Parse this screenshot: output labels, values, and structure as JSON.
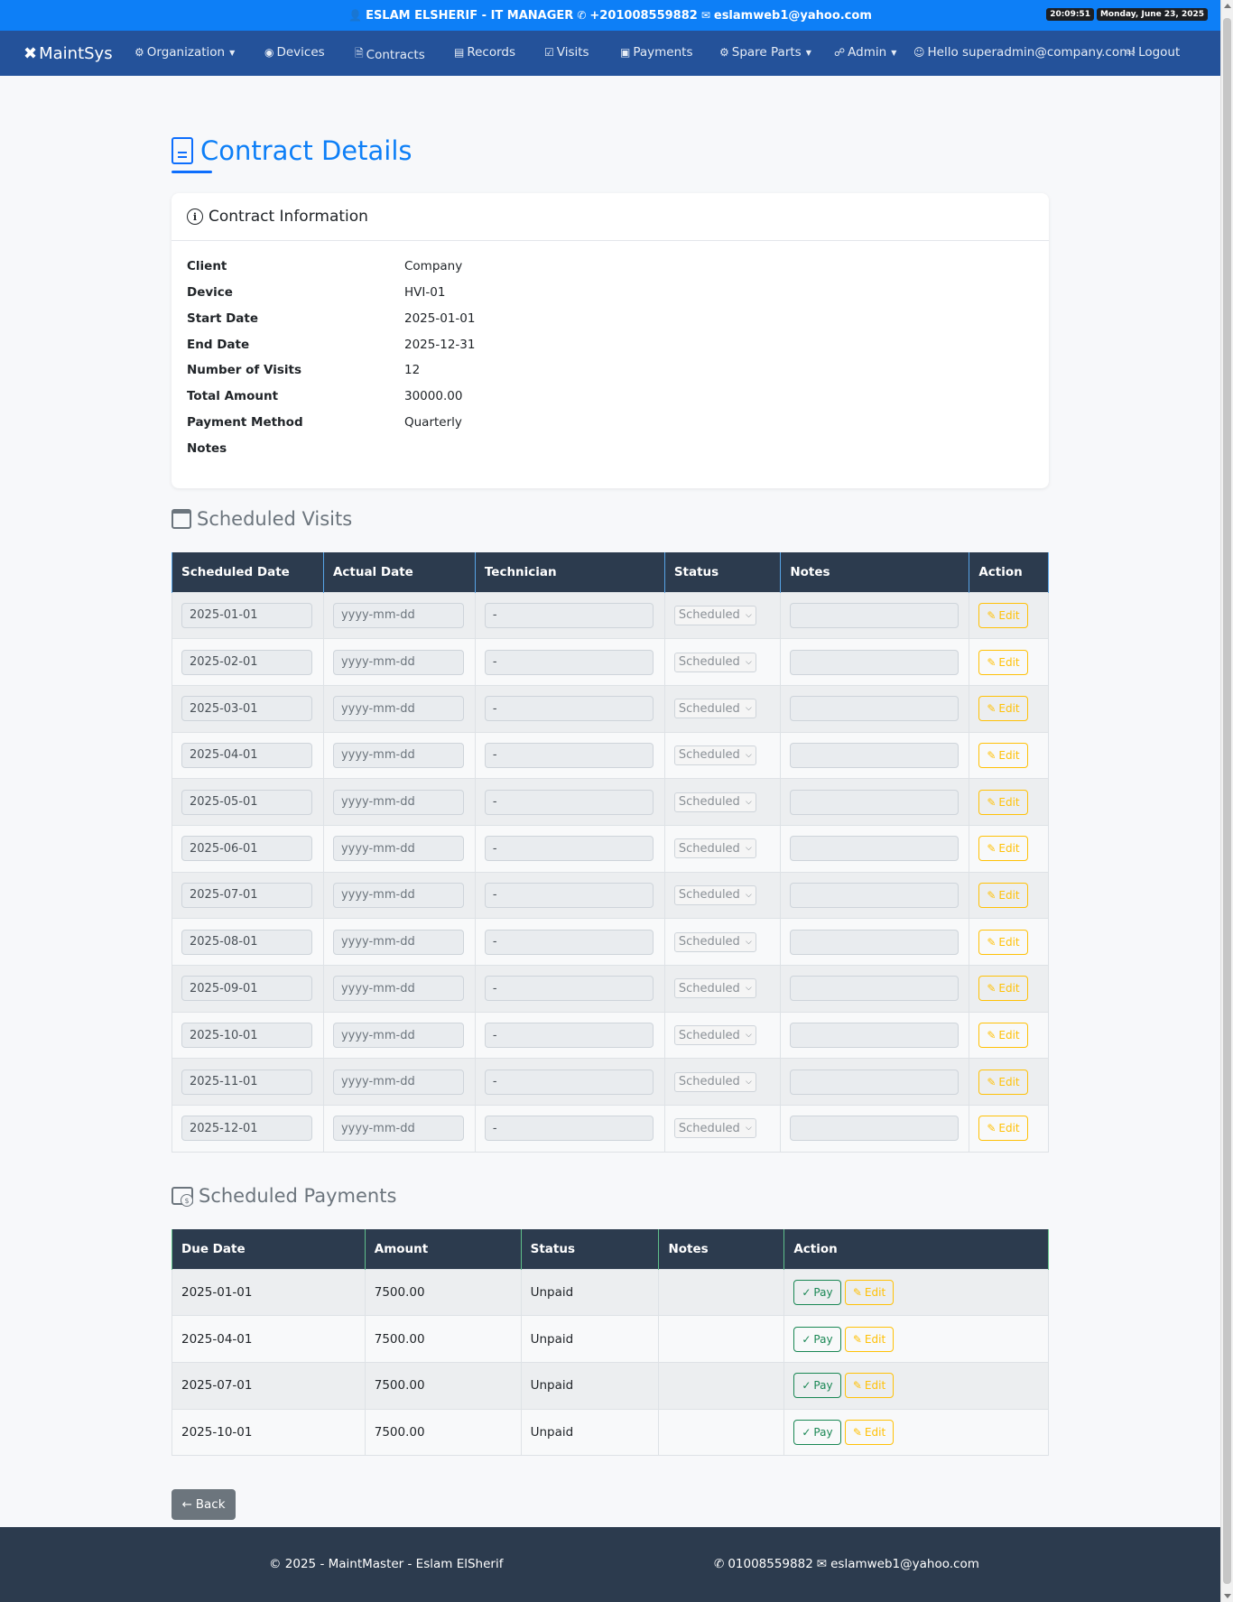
{
  "topbar": {
    "user": "ESLAM ELSHERIF - IT MANAGER",
    "phone": "+201008559882",
    "email": "eslamweb1@yahoo.com",
    "time": "20:09:51",
    "date": "Monday, June 23, 2025"
  },
  "nav": {
    "brand": "MaintSys",
    "organization": "Organization",
    "devices": "Devices",
    "contracts": "Contracts",
    "records": "Records",
    "visits": "Visits",
    "payments": "Payments",
    "spare_parts": "Spare Parts",
    "admin": "Admin",
    "greeting": "Hello superadmin@company.com!",
    "logout": "Logout"
  },
  "page_title": "Contract Details",
  "contract": {
    "header": "Contract Information",
    "fields": [
      {
        "label": "Client",
        "value": "Company"
      },
      {
        "label": "Device",
        "value": "HVI-01"
      },
      {
        "label": "Start Date",
        "value": "2025-01-01"
      },
      {
        "label": "End Date",
        "value": "2025-12-31"
      },
      {
        "label": "Number of Visits",
        "value": "12"
      },
      {
        "label": "Total Amount",
        "value": "30000.00"
      },
      {
        "label": "Payment Method",
        "value": "Quarterly"
      },
      {
        "label": "Notes",
        "value": ""
      }
    ]
  },
  "visits": {
    "title": "Scheduled Visits",
    "headers": [
      "Scheduled Date",
      "Actual Date",
      "Technician",
      "Status",
      "Notes",
      "Action"
    ],
    "actual_placeholder": "yyyy-mm-dd",
    "technician": "-",
    "status": "Scheduled",
    "edit_label": "Edit",
    "dates": [
      "2025-01-01",
      "2025-02-01",
      "2025-03-01",
      "2025-04-01",
      "2025-05-01",
      "2025-06-01",
      "2025-07-01",
      "2025-08-01",
      "2025-09-01",
      "2025-10-01",
      "2025-11-01",
      "2025-12-01"
    ]
  },
  "payments": {
    "title": "Scheduled Payments",
    "headers": [
      "Due Date",
      "Amount",
      "Status",
      "Notes",
      "Action"
    ],
    "pay_label": "Pay",
    "edit_label": "Edit",
    "rows": [
      {
        "due": "2025-01-01",
        "amount": "7500.00",
        "status": "Unpaid",
        "notes": ""
      },
      {
        "due": "2025-04-01",
        "amount": "7500.00",
        "status": "Unpaid",
        "notes": ""
      },
      {
        "due": "2025-07-01",
        "amount": "7500.00",
        "status": "Unpaid",
        "notes": ""
      },
      {
        "due": "2025-10-01",
        "amount": "7500.00",
        "status": "Unpaid",
        "notes": ""
      }
    ]
  },
  "back_label": "Back",
  "footer": {
    "copyright": "© 2025 - MaintMaster - Eslam ElSherif",
    "phone": "01008559882",
    "email": "eslamweb1@yahoo.com"
  },
  "colors": {
    "topbar": "#0d7ff7",
    "navbar": "#24529a",
    "table_header": "#2c3b4e",
    "title": "#0d7ff7",
    "edit": "#ffc107",
    "pay": "#198754"
  }
}
